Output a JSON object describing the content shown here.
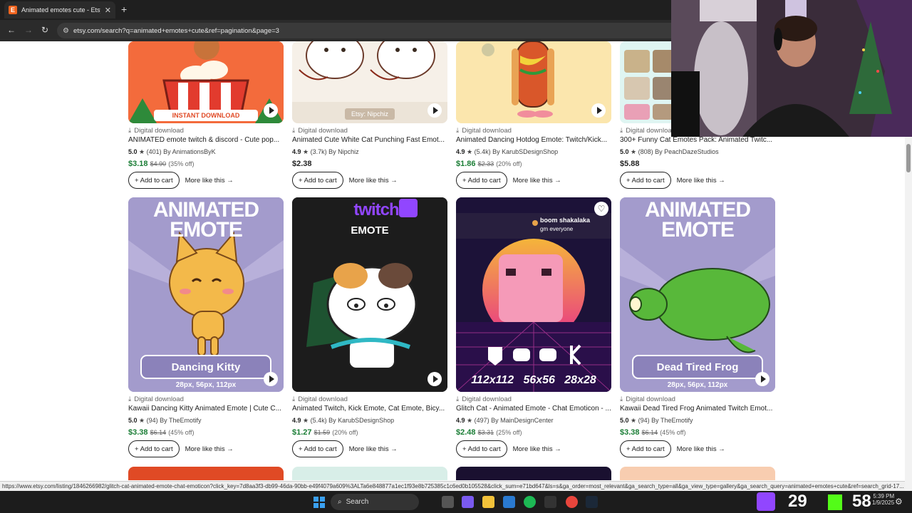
{
  "browser": {
    "tab_title": "Animated emotes cute - Etsy",
    "tab_favicon": "E",
    "url": "etsy.com/search?q=animated+emotes+cute&ref=pagination&page=3"
  },
  "row1": [
    {
      "dl": "Digital download",
      "title": "ANIMATED emote twitch & discord - Cute pop...",
      "rating": "5.0",
      "reviews": "(401)",
      "shop": "By AnimationsByK",
      "price": "$3.18",
      "old": "$4.90",
      "off": "(35% off)",
      "thumb_text": "INSTANT DOWNLOAD"
    },
    {
      "dl": "Digital download",
      "title": "Animated Cute White Cat Punching Fast Emot...",
      "rating": "4.9",
      "reviews": "(3.7k)",
      "shop": "By Nipchiz",
      "price": "$2.38",
      "old": "",
      "off": "",
      "thumb_text": "Etsy: Nipchiz"
    },
    {
      "dl": "Digital download",
      "title": "Animated Dancing Hotdog Emote: Twitch/Kick...",
      "rating": "4.9",
      "reviews": "(5.4k)",
      "shop": "By KarubSDesignShop",
      "price": "$1.86",
      "old": "$2.33",
      "off": "(20% off)",
      "thumb_text": ""
    },
    {
      "dl": "Digital download",
      "title": "300+ Funny Cat Emotes Pack: Animated Twitc...",
      "rating": "5.0",
      "reviews": "(808)",
      "shop": "By PeachDazeStudios",
      "price": "$5.88",
      "old": "",
      "off": "",
      "thumb_text": ""
    }
  ],
  "row2": [
    {
      "dl": "Digital download",
      "title": "Kawaii Dancing Kitty Animated Emote | Cute C...",
      "rating": "5.0",
      "reviews": "(94)",
      "shop": "By TheEmotify",
      "price": "$3.38",
      "old": "$6.14",
      "off": "(45% off)",
      "thumb_top": "ANIMATED",
      "thumb_mid": "EMOTE",
      "thumb_label": "Dancing Kitty",
      "thumb_sizes": "28px, 56px, 112px"
    },
    {
      "dl": "Digital download",
      "title": "Animated Twitch, Kick Emote, Cat Emote, Bicy...",
      "rating": "4.9",
      "reviews": "(5.4k)",
      "shop": "By KarubSDesignShop",
      "price": "$1.27",
      "old": "$1.59",
      "off": "(20% off)",
      "thumb_top": "twitch",
      "thumb_mid": "EMOTE",
      "thumb_label": "",
      "thumb_sizes": ""
    },
    {
      "dl": "Digital download",
      "title": "Glitch Cat - Animated Emote - Chat Emoticon - ...",
      "rating": "4.9",
      "reviews": "(497)",
      "shop": "By MainDesignCenter",
      "price": "$2.48",
      "old": "$3.31",
      "off": "(25% off)",
      "thumb_top": "boom shakalaka",
      "thumb_mid": "gm everyone",
      "thumb_label": "112x112   56x56   28x28",
      "thumb_sizes": ""
    },
    {
      "dl": "Digital download",
      "title": "Kawaii Dead Tired Frog Animated Twitch Emot...",
      "rating": "5.0",
      "reviews": "(94)",
      "shop": "By TheEmotify",
      "price": "$3.38",
      "old": "$6.14",
      "off": "(45% off)",
      "thumb_top": "ANIMATED",
      "thumb_mid": "EMOTE",
      "thumb_label": "Dead Tired Frog",
      "thumb_sizes": "28px, 56px, 112px"
    }
  ],
  "labels": {
    "add_to_cart": "+ Add to cart",
    "more_like_this": "More like this →"
  },
  "status_url": "https://www.etsy.com/listing/1846266982/glitch-cat-animated-emote-chat-emoticon?click_key=7d8aa3f3-db99-46da-90bb-e49f4079a609%3ALTa6e848877a1ec1f93e8b725385c1c6ed0b105528&click_sum=e71bd647&ls=s&ga_order=most_relevant&ga_search_type=all&ga_view_type=gallery&ga_search_query=animated+emotes+cute&ref=search_grid-17...",
  "taskbar": {
    "search_placeholder": "Search",
    "count": "29",
    "overlay": "58",
    "time": "5:39 PM",
    "date": "1/9/2025"
  },
  "accent": {
    "etsy_orange": "#f1641e",
    "sale_green": "#1a7d35"
  }
}
